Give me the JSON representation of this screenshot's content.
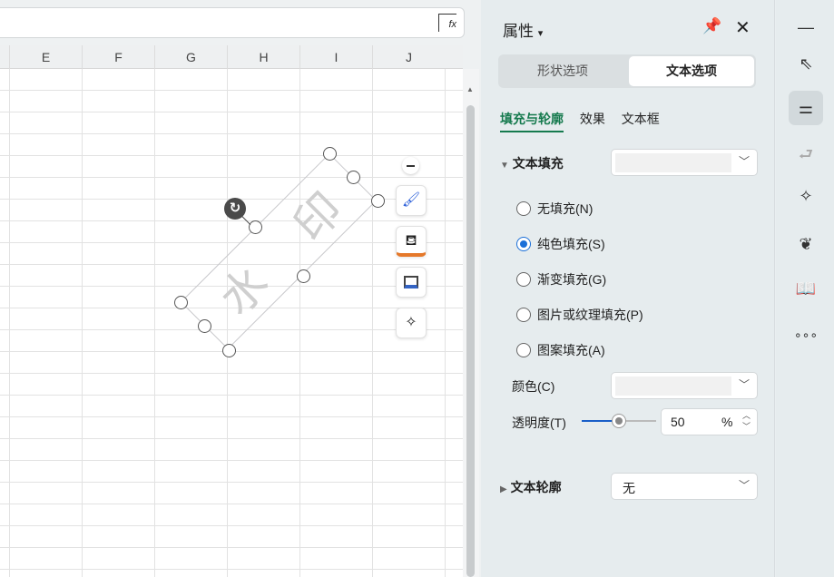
{
  "formula_bar": {
    "fx_label": "fx"
  },
  "columns": [
    "E",
    "F",
    "G",
    "H",
    "I",
    "J"
  ],
  "watermark": {
    "chars": [
      "水",
      "印"
    ]
  },
  "panel": {
    "title": "属性",
    "title_caret": "▾",
    "tabs": [
      {
        "label": "形状选项",
        "active": false
      },
      {
        "label": "文本选项",
        "active": true
      }
    ],
    "subtabs": [
      {
        "label": "填充与轮廓",
        "active": true
      },
      {
        "label": "效果"
      },
      {
        "label": "文本框"
      }
    ],
    "text_fill": {
      "label": "文本填充",
      "options": [
        "无填充(N)",
        "纯色填充(S)",
        "渐变填充(G)",
        "图片或纹理填充(P)",
        "图案填充(A)"
      ],
      "selected": 1,
      "color_label": "颜色(C)",
      "transparency_label": "透明度(T)",
      "transparency": "50",
      "transparency_unit": "%",
      "transparency_fraction": 0.5
    },
    "text_outline": {
      "label": "文本轮廓",
      "value": "无"
    }
  },
  "colors": {
    "accent": "#167a4e",
    "radio": "#1a6fd8"
  }
}
